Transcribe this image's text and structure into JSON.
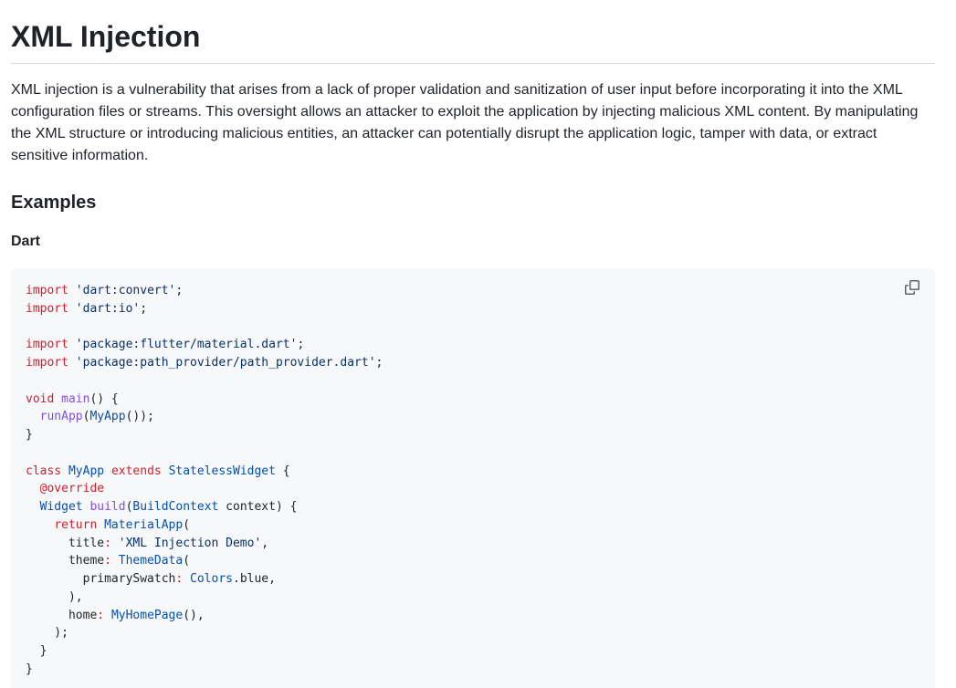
{
  "page": {
    "title": "XML Injection",
    "intro": "XML injection is a vulnerability that arises from a lack of proper validation and sanitization of user input before incorporating it into the XML configuration files or streams. This oversight allows an attacker to exploit the application by injecting malicious XML content. By manipulating the XML structure or introducing malicious entities, an attacker can potentially disrupt the application logic, tamper with data, or extract sensitive information.",
    "examples_heading": "Examples",
    "language_heading": "Dart"
  },
  "code": {
    "language": "dart",
    "lines": [
      [
        {
          "t": "kw",
          "v": "import"
        },
        {
          "t": "",
          "v": " "
        },
        {
          "t": "str",
          "v": "'dart:convert'"
        },
        {
          "t": "",
          "v": ";"
        }
      ],
      [
        {
          "t": "kw",
          "v": "import"
        },
        {
          "t": "",
          "v": " "
        },
        {
          "t": "str",
          "v": "'dart:io'"
        },
        {
          "t": "",
          "v": ";"
        }
      ],
      [],
      [
        {
          "t": "kw",
          "v": "import"
        },
        {
          "t": "",
          "v": " "
        },
        {
          "t": "str",
          "v": "'package:flutter/material.dart'"
        },
        {
          "t": "",
          "v": ";"
        }
      ],
      [
        {
          "t": "kw",
          "v": "import"
        },
        {
          "t": "",
          "v": " "
        },
        {
          "t": "str",
          "v": "'package:path_provider/path_provider.dart'"
        },
        {
          "t": "",
          "v": ";"
        }
      ],
      [],
      [
        {
          "t": "kw",
          "v": "void"
        },
        {
          "t": "",
          "v": " "
        },
        {
          "t": "fn",
          "v": "main"
        },
        {
          "t": "",
          "v": "() {"
        }
      ],
      [
        {
          "t": "",
          "v": "  "
        },
        {
          "t": "fn",
          "v": "runApp"
        },
        {
          "t": "",
          "v": "("
        },
        {
          "t": "ty",
          "v": "MyApp"
        },
        {
          "t": "",
          "v": "());"
        }
      ],
      [
        {
          "t": "",
          "v": "}"
        }
      ],
      [],
      [
        {
          "t": "kw",
          "v": "class"
        },
        {
          "t": "",
          "v": " "
        },
        {
          "t": "ty",
          "v": "MyApp"
        },
        {
          "t": "",
          "v": " "
        },
        {
          "t": "kw",
          "v": "extends"
        },
        {
          "t": "",
          "v": " "
        },
        {
          "t": "ty",
          "v": "StatelessWidget"
        },
        {
          "t": "",
          "v": " {"
        }
      ],
      [
        {
          "t": "",
          "v": "  "
        },
        {
          "t": "kw",
          "v": "@override"
        }
      ],
      [
        {
          "t": "",
          "v": "  "
        },
        {
          "t": "ty",
          "v": "Widget"
        },
        {
          "t": "",
          "v": " "
        },
        {
          "t": "fn",
          "v": "build"
        },
        {
          "t": "",
          "v": "("
        },
        {
          "t": "ty",
          "v": "BuildContext"
        },
        {
          "t": "",
          "v": " context) {"
        }
      ],
      [
        {
          "t": "",
          "v": "    "
        },
        {
          "t": "kw",
          "v": "return"
        },
        {
          "t": "",
          "v": " "
        },
        {
          "t": "ty",
          "v": "MaterialApp"
        },
        {
          "t": "",
          "v": "("
        }
      ],
      [
        {
          "t": "",
          "v": "      title"
        },
        {
          "t": "kw",
          "v": ":"
        },
        {
          "t": "",
          "v": " "
        },
        {
          "t": "str",
          "v": "'XML Injection Demo'"
        },
        {
          "t": "",
          "v": ","
        }
      ],
      [
        {
          "t": "",
          "v": "      theme"
        },
        {
          "t": "kw",
          "v": ":"
        },
        {
          "t": "",
          "v": " "
        },
        {
          "t": "ty",
          "v": "ThemeData"
        },
        {
          "t": "",
          "v": "("
        }
      ],
      [
        {
          "t": "",
          "v": "        primarySwatch"
        },
        {
          "t": "kw",
          "v": ":"
        },
        {
          "t": "",
          "v": " "
        },
        {
          "t": "ty",
          "v": "Colors"
        },
        {
          "t": "",
          "v": ".blue,"
        }
      ],
      [
        {
          "t": "",
          "v": "      ),"
        }
      ],
      [
        {
          "t": "",
          "v": "      home"
        },
        {
          "t": "kw",
          "v": ":"
        },
        {
          "t": "",
          "v": " "
        },
        {
          "t": "ty",
          "v": "MyHomePage"
        },
        {
          "t": "",
          "v": "(),"
        }
      ],
      [
        {
          "t": "",
          "v": "    );"
        }
      ],
      [
        {
          "t": "",
          "v": "  }"
        }
      ],
      [
        {
          "t": "",
          "v": "}"
        }
      ]
    ]
  },
  "icons": {
    "copy": "copy-icon"
  },
  "colors": {
    "keyword": "#cf222e",
    "string": "#0a3069",
    "function": "#8250df",
    "type": "#0550ae",
    "code_background": "#f6f8fa",
    "text": "#1f2328"
  }
}
